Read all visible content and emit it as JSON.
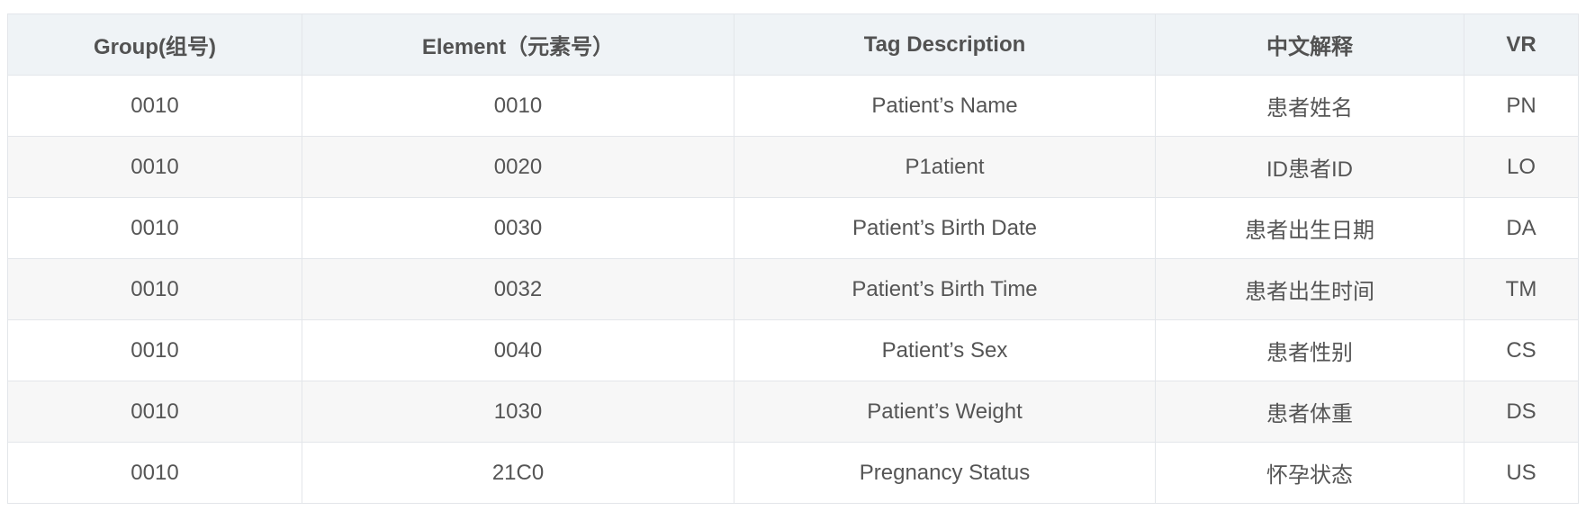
{
  "table": {
    "headers": [
      "Group(组号)",
      "Element（元素号）",
      "Tag Description",
      "中文解释",
      "VR"
    ],
    "rows": [
      [
        "0010",
        "0010",
        "Patient’s Name",
        "患者姓名",
        "PN"
      ],
      [
        "0010",
        "0020",
        "P1atient",
        "ID患者ID",
        "LO"
      ],
      [
        "0010",
        "0030",
        "Patient’s Birth Date",
        "患者出生日期",
        "DA"
      ],
      [
        "0010",
        "0032",
        "Patient’s Birth Time",
        "患者出生时间",
        "TM"
      ],
      [
        "0010",
        "0040",
        "Patient’s Sex",
        "患者性别",
        "CS"
      ],
      [
        "0010",
        "1030",
        "Patient’s Weight",
        "患者体重",
        "DS"
      ],
      [
        "0010",
        "21C0",
        "Pregnancy Status",
        "怀孕状态",
        "US"
      ]
    ]
  }
}
